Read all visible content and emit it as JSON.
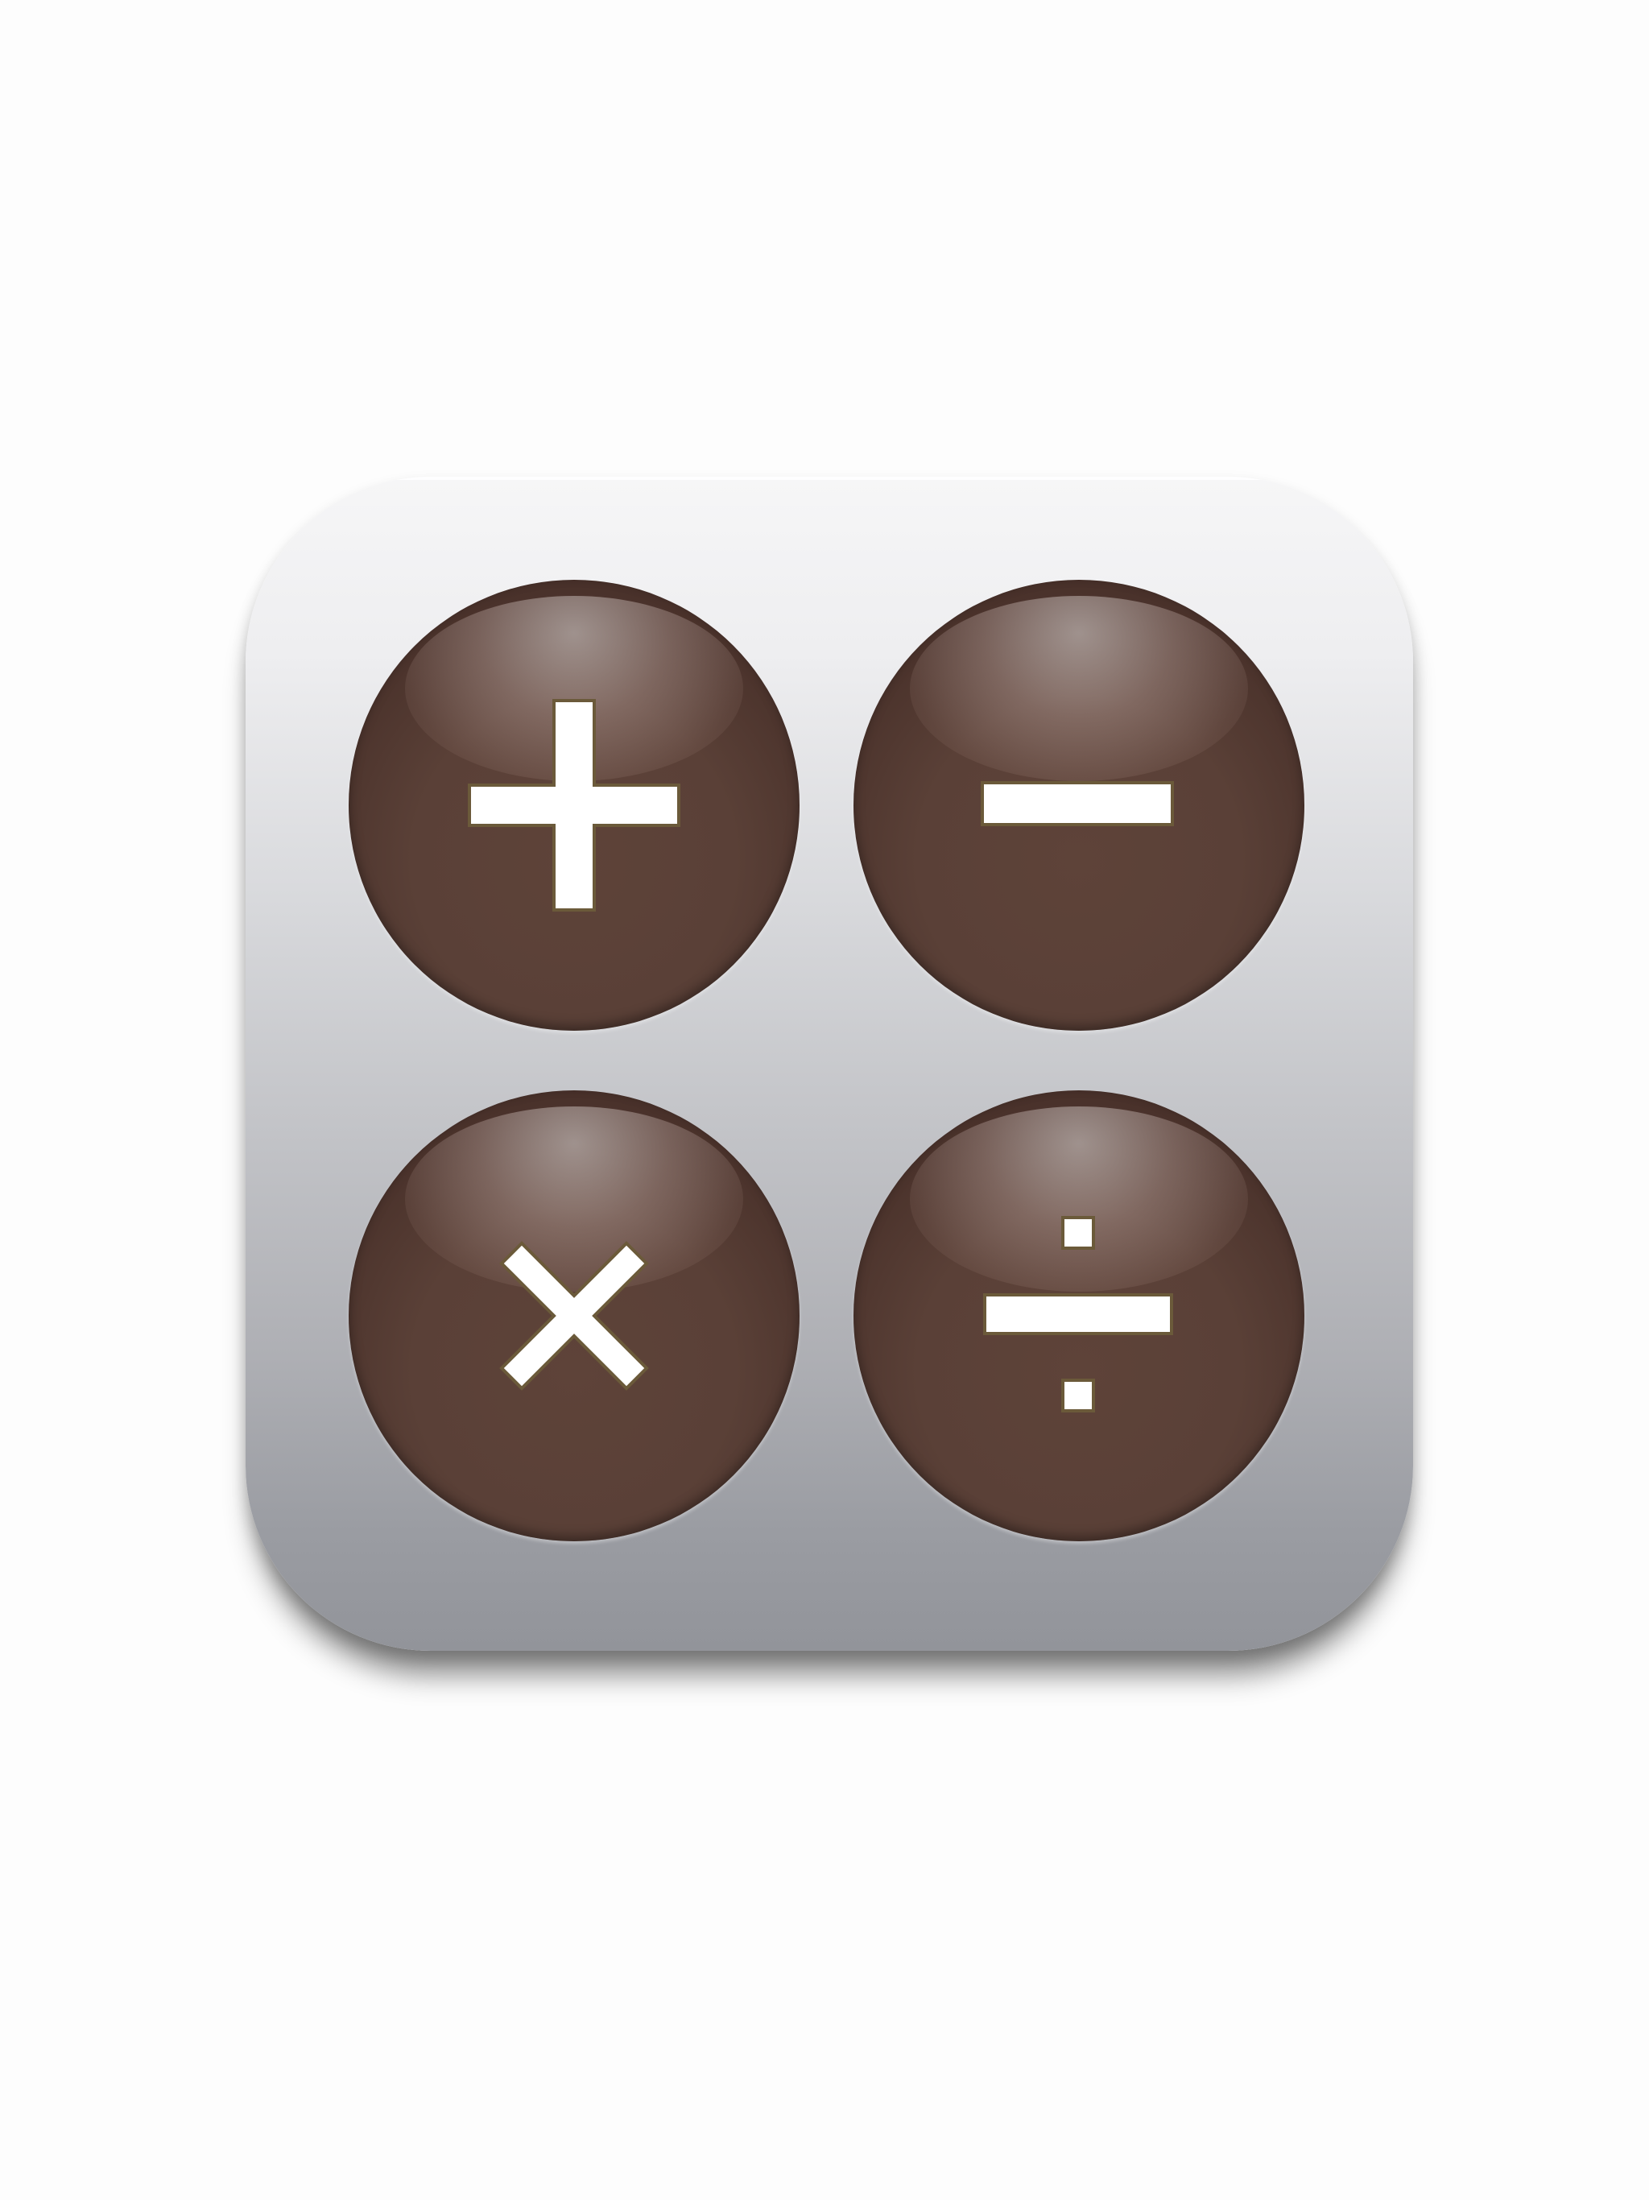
{
  "app_icon": {
    "name": "calculator-app-icon",
    "background_top": "#f6f6f7",
    "background_bottom": "#92949a",
    "key_color": "#5a4037",
    "glyph_color": "#ffffff"
  },
  "keys": [
    {
      "label": "+",
      "icon": "plus-icon"
    },
    {
      "label": "−",
      "icon": "minus-icon"
    },
    {
      "label": "×",
      "icon": "multiply-icon"
    },
    {
      "label": "÷",
      "icon": "divide-icon"
    }
  ]
}
